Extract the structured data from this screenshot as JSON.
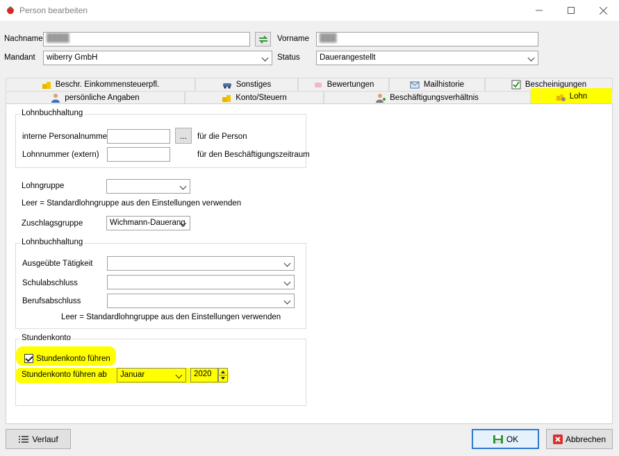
{
  "window": {
    "title": "Person bearbeiten",
    "app_icon": "strawberry-icon",
    "controls": [
      "minimize-icon",
      "maximize-icon",
      "close-icon"
    ]
  },
  "header": {
    "nachname_label": "Nachname",
    "vorname_label": "Vorname",
    "mandant_label": "Mandant",
    "mandant_value": "wiberry GmbH",
    "status_label": "Status",
    "status_value": "Dauerangestellt",
    "swap_icon": "swap-icon"
  },
  "tabs_row1": [
    {
      "label": "Beschr. Einkommensteuerpfl.",
      "icon": "coins-icon"
    },
    {
      "label": "Sonstiges",
      "icon": "car-icon"
    },
    {
      "label": "Bewertungen",
      "icon": "eraser-icon"
    },
    {
      "label": "Mailhistorie",
      "icon": "mail-icon"
    },
    {
      "label": "Bescheinigungen",
      "icon": "checklist-icon"
    }
  ],
  "tabs_row2": [
    {
      "label": "persönliche Angaben",
      "icon": "person-icon"
    },
    {
      "label": "Konto/Steuern",
      "icon": "coins-icon"
    },
    {
      "label": "Beschäftigungsverhältnis",
      "icon": "person-add-icon"
    },
    {
      "label": "Lohn",
      "icon": "coins-gear-icon"
    }
  ],
  "lohnbuchhaltung1": {
    "title": "Lohnbuchhaltung",
    "personalnummer_label": "interne Personalnummer",
    "personalnummer_value": "",
    "ellipsis_label": "...",
    "personalnummer_hint": "für die Person",
    "lohnnummer_label": "Lohnnummer (extern)",
    "lohnnummer_value": "",
    "lohnnummer_hint": "für den Beschäftigungszeitraum"
  },
  "lohngruppe": {
    "label": "Lohngruppe",
    "value": "",
    "hint": "Leer = Standardlohngruppe aus den Einstellungen verwenden",
    "zuschlag_label": "Zuschlagsgruppe",
    "zuschlag_value": "Wichmann-Dauerang"
  },
  "lohnbuchhaltung2": {
    "title": "Lohnbuchhaltung",
    "taetigkeit_label": "Ausgeübte Tätigkeit",
    "schul_label": "Schulabschluss",
    "beruf_label": "Berufsabschluss",
    "hint": "Leer = Standardlohngruppe aus den Einstellungen verwenden"
  },
  "stundenkonto": {
    "title": "Stundenkonto",
    "checkbox_label": "Stundenkonto führen",
    "checked": true,
    "ab_label": "Stundenkonto führen ab",
    "month_value": "Januar",
    "year_value": "2020"
  },
  "footer": {
    "verlauf_label": "Verlauf",
    "ok_label": "OK",
    "abbrechen_label": "Abbrechen"
  },
  "colors": {
    "highlight": "#ffff00",
    "window_bg": "#f0f0f0"
  }
}
